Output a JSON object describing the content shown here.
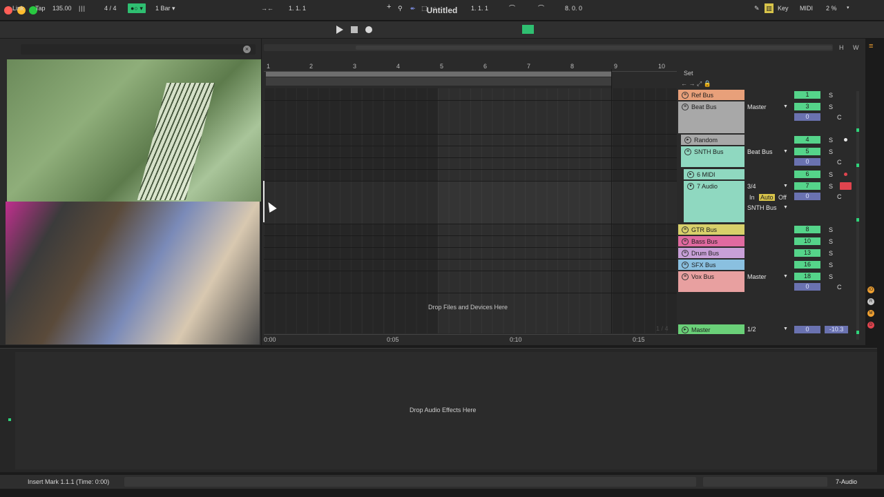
{
  "window": {
    "title": "Untitled"
  },
  "controlbar": {
    "link": "Link",
    "tap": "Tap",
    "tempo": "135.00",
    "metronome_glyph": "|||",
    "signature": "4 / 4",
    "follow_indicator": "●○ ▾",
    "quantize": "1 Bar ▾",
    "arrangement_position": "1.   1.   1",
    "punch_plus": "+",
    "loop_start": "1.   1.   1",
    "loop_length": "8.   0.   0",
    "key": "Key",
    "midi": "MIDI",
    "cpu": "2 %"
  },
  "arrangement": {
    "bar_numbers": [
      "1",
      "2",
      "3",
      "4",
      "5",
      "6",
      "7",
      "8",
      "9",
      "10"
    ],
    "time_labels": [
      "0:00",
      "0:05",
      "0:10",
      "0:15"
    ],
    "drop_hint": "Drop Files and Devices Here",
    "scroll_h": "H",
    "scroll_w": "W"
  },
  "mixer": {
    "set_label": "Set",
    "tracks": [
      {
        "name": "Ref Bus",
        "color": "#e8a07a",
        "num": "1",
        "solo": "S"
      },
      {
        "name": "Beat Bus",
        "color": "#a8a8a8",
        "route": "Master",
        "num": "3",
        "pan": "0",
        "solo": "S",
        "c": "C"
      },
      {
        "name": "Random",
        "color": "#a8a8a8",
        "num": "4",
        "solo": "S"
      },
      {
        "name": "SNTH Bus",
        "color": "#8fd8c0",
        "route": "Beat Bus",
        "num": "5",
        "pan": "0",
        "solo": "S",
        "c": "C"
      },
      {
        "name": "6 MIDI",
        "color": "#8fd8c0",
        "num": "6",
        "solo": "S"
      },
      {
        "name": "7 Audio",
        "color": "#8fd8c0",
        "route": "3/4",
        "route2": "SNTH Bus",
        "num": "7",
        "pan": "0",
        "solo": "S",
        "c": "C",
        "mon_in": "In",
        "mon_auto": "Auto",
        "mon_off": "Off"
      },
      {
        "name": "GTR Bus",
        "color": "#d8d06a",
        "num": "8",
        "solo": "S"
      },
      {
        "name": "Bass Bus",
        "color": "#e06aa0",
        "num": "10",
        "solo": "S"
      },
      {
        "name": "Drum Bus",
        "color": "#c8a0d8",
        "num": "13",
        "solo": "S"
      },
      {
        "name": "SFX Bus",
        "color": "#8ac0e0",
        "num": "16",
        "solo": "S"
      },
      {
        "name": "Vox Bus",
        "color": "#e8a0a0",
        "route": "Master",
        "num": "18",
        "pan": "0",
        "solo": "S",
        "c": "C"
      }
    ],
    "master": {
      "name": "Master",
      "color": "#6ad078",
      "route": "1/2",
      "pan": "0",
      "volume": "-10.3",
      "overlay": "1 / 4"
    }
  },
  "side_icons": [
    "IO",
    "R",
    "M",
    "D"
  ],
  "detail": {
    "drop_hint": "Drop Audio Effects Here"
  },
  "status": {
    "message": "Insert Mark 1.1.1 (Time: 0:00)",
    "track": "7-Audio"
  }
}
